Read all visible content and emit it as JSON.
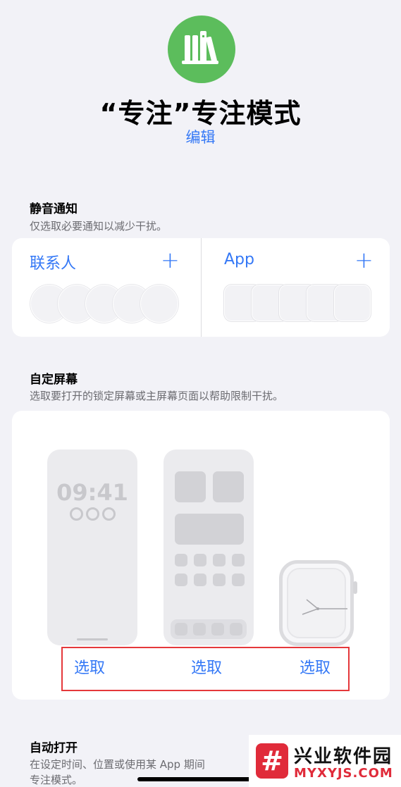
{
  "header": {
    "title": "“专注”专注模式",
    "edit_label": "编辑",
    "icon": "books-icon",
    "icon_color": "#5cbd5c"
  },
  "silence": {
    "title": "静音通知",
    "subtitle": "仅选取必要通知以减少干扰。",
    "people_label": "联系人",
    "apps_label": "App",
    "add_symbol": "+"
  },
  "screens": {
    "title": "自定屏幕",
    "subtitle": "选取要打开的锁定屏幕或主屏幕页面以帮助限制干扰。",
    "lock_time": "09:41",
    "choose_labels": [
      "选取",
      "选取",
      "选取"
    ]
  },
  "auto": {
    "title": "自动打开",
    "subtitle_line1": "在设定时间、位置或使用某 App 期间",
    "subtitle_line2": "专注模式。"
  },
  "watermark": {
    "logo": "#",
    "name": "兴业软件园",
    "url": "MYXYJS.COM"
  },
  "colors": {
    "accent": "#3478f6",
    "background": "#f2f2f7",
    "highlight_box": "#e5383b"
  }
}
